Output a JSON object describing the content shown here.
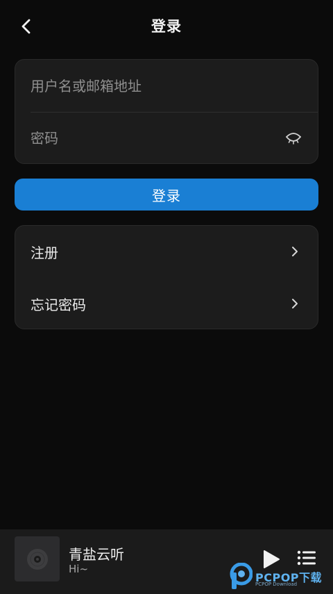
{
  "header": {
    "title": "登录",
    "back_icon": "chevron-left-icon"
  },
  "form": {
    "username_placeholder": "用户名或邮箱地址",
    "username_value": "",
    "password_placeholder": "密码",
    "password_value": "",
    "password_toggle_icon": "eye-closed-icon"
  },
  "login_button": {
    "label": "登录",
    "color": "#1a7fd4"
  },
  "menu": {
    "items": [
      {
        "label": "注册",
        "icon": "chevron-right-icon"
      },
      {
        "label": "忘记密码",
        "icon": "chevron-right-icon"
      }
    ]
  },
  "player": {
    "song_title": "青盐云听",
    "song_subtitle": "Hi~",
    "cover_icon": "vinyl-disc-icon",
    "play_icon": "play-icon",
    "playlist_icon": "playlist-icon"
  },
  "watermark": {
    "text": "PCPOP下载",
    "sub": "PCPOP Download"
  }
}
